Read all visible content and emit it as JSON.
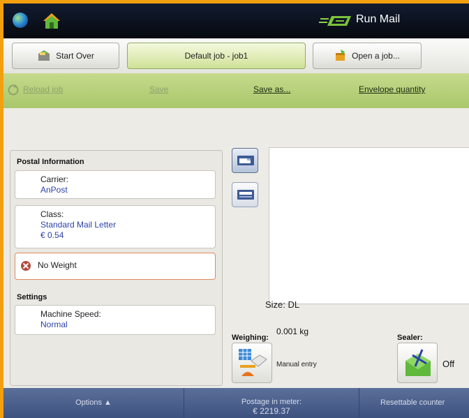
{
  "titlebar": {
    "title": "Run Mail",
    "icons": [
      "globe-icon",
      "home-icon",
      "run-mail-logo"
    ]
  },
  "tabs": [
    {
      "label": "Start Over",
      "icon": "start-over-icon"
    },
    {
      "label": "Default job - job1",
      "active": true
    },
    {
      "label": "Open a job...",
      "icon": "open-job-icon"
    }
  ],
  "actions": {
    "reload": "Reload job",
    "save": "Save",
    "save_as": "Save as...",
    "envelope_quantity": "Envelope quantity"
  },
  "postal": {
    "heading": "Postal Information",
    "carrier_label": "Carrier:",
    "carrier_value": "AnPost",
    "class_label": "Class:",
    "class_value": "Standard Mail Letter",
    "class_price": "€ 0.54",
    "weight_status": "No Weight"
  },
  "settings": {
    "heading": "Settings",
    "speed_label": "Machine Speed:",
    "speed_value": "Normal"
  },
  "preview": {
    "size_label": "Size: DL"
  },
  "weighing": {
    "label": "Weighing:",
    "value": "0.001 kg",
    "mode": "Manual entry"
  },
  "sealer": {
    "label": "Sealer:",
    "value": "Off"
  },
  "bottombar": {
    "options": "Options ▲",
    "postage_label": "Postage in meter:",
    "postage_value": "€ 2219.37",
    "resettable": "Resettable counter"
  },
  "colors": {
    "accent_green": "#a9c76b",
    "frame_orange": "#f2a010",
    "link_blue": "#2b43a8",
    "bottom_bar": "#4a5e8c"
  }
}
